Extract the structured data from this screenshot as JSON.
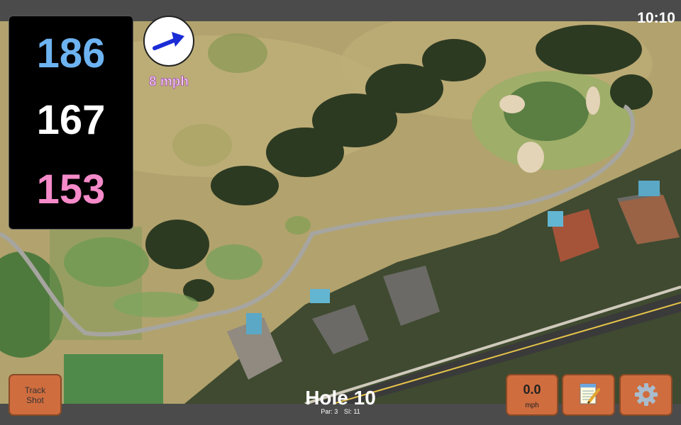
{
  "status_bar": {
    "time": "10:10"
  },
  "yardage": {
    "back": "186",
    "middle": "167",
    "front": "153",
    "colors": {
      "back": "#6db3f2",
      "middle": "#ffffff",
      "front": "#f58ac9"
    }
  },
  "wind": {
    "speed_label": "8 mph",
    "direction_icon": "arrow-right-up-icon",
    "arrow_color": "#1a2cd6",
    "speed_color": "#e8b6f5"
  },
  "buttons": {
    "track_shot_line1": "Track",
    "track_shot_line2": "Shot",
    "speed_value": "0.0",
    "speed_unit": "mph",
    "notes_icon": "notepad-icon",
    "settings_icon": "gear-icon",
    "color": "#cf6d3e"
  },
  "hole": {
    "title": "Hole 10",
    "par": "Par: 3",
    "stroke_index": "SI: 11"
  }
}
